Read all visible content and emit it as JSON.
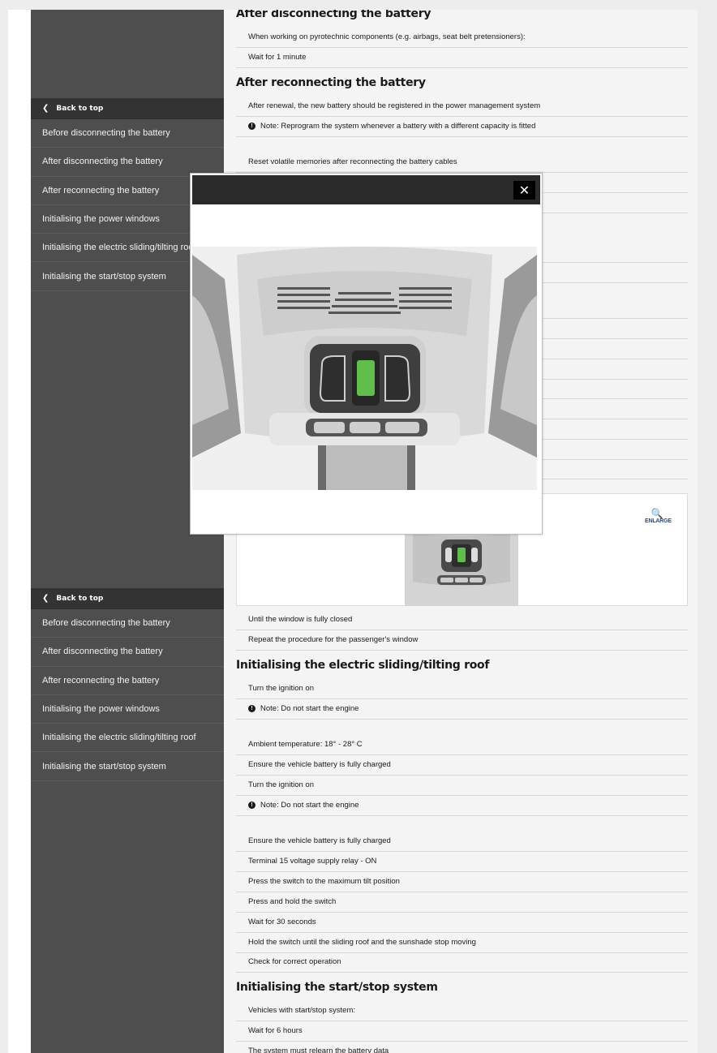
{
  "sidebar": {
    "back_to_top": "Back to top",
    "items": [
      "Before disconnecting the battery",
      "After disconnecting the battery",
      "After reconnecting the battery",
      "Initialising the power windows",
      "Initialising the electric sliding/tilting roof",
      "Initialising the start/stop system"
    ]
  },
  "content": {
    "top_heading": "After disconnecting the battery",
    "rows_a": [
      "When working on pyrotechnic components (e.g. airbags, seat belt pretensioners):",
      "Wait for 1 minute"
    ],
    "reconnect_heading": "After reconnecting the battery",
    "rows_b1": "After renewal, the new battery should be registered in the power management system",
    "rows_b2": "Note: Reprogram the system whenever a battery with a different capacity is fitted",
    "rows_b3": "Reset volatile memories after reconnecting the battery cables",
    "rows_c": [
      "Until the window is fully closed",
      "Repeat the procedure for the passenger's window"
    ],
    "roof_heading": "Initialising the electric sliding/tilting roof",
    "roof_rows": [
      "Turn the ignition on",
      "Note: Do not start the engine",
      "Ambient temperature: 18° - 28° C",
      "Ensure the vehicle battery is fully charged",
      "Turn the ignition on",
      "Note: Do not start the engine",
      "Ensure the vehicle battery is fully charged",
      "Terminal 15 voltage supply relay - ON",
      "Press the switch to the maximum tilt position",
      "Press and hold the switch",
      "Wait for 30 seconds",
      "Hold the switch until the sliding roof and the sunshade stop moving",
      "Check for correct operation"
    ],
    "startstop_heading": "Initialising the start/stop system",
    "startstop_rows": [
      "Vehicles with start/stop system:",
      "Wait for 6 hours",
      "The system must relearn the battery data"
    ],
    "enlarge_label": "ENLARGE"
  },
  "modal": {
    "close_icon": "close-icon"
  },
  "colors": {
    "accent": "#1d4f91",
    "sidebar": "#4e4e4e",
    "highlight_switch": "#5fbf4a"
  }
}
